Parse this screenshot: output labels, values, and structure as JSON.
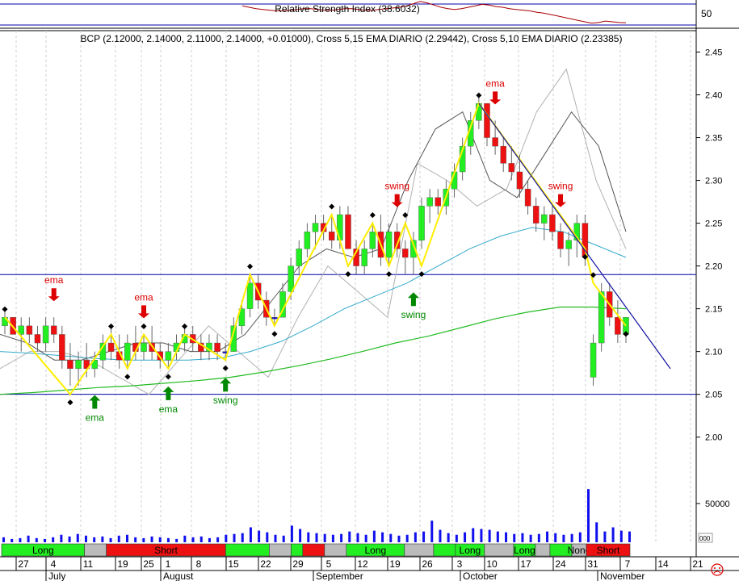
{
  "rsi": {
    "title": "Relative Strength Index (38.6032)",
    "level_label": "50",
    "values": [
      62,
      60,
      58,
      57,
      56,
      55,
      55,
      56,
      57,
      58,
      58,
      57,
      56,
      56,
      57,
      58,
      58,
      57,
      56,
      56,
      57,
      58,
      59,
      60,
      62,
      65,
      68,
      66,
      63,
      60,
      58,
      57,
      58,
      60,
      62,
      64,
      63,
      61,
      60,
      58,
      57,
      56,
      55,
      53,
      52,
      50,
      48,
      46,
      44,
      42,
      40,
      38,
      39,
      41,
      40,
      39,
      38.6
    ]
  },
  "main_title": "BCP (2.12000, 2.14000, 2.11000, 2.14000, +0.01000), Cross 5,15 EMA DIARIO (2.29442), Cross 5,10 EMA DIARIO (2.23385)",
  "chart_data": {
    "type": "candlestick",
    "y_ticks": [
      "2.45",
      "2.40",
      "2.35",
      "2.30",
      "2.25",
      "2.20",
      "2.15",
      "2.10",
      "2.05",
      "2.00"
    ],
    "ylim": [
      1.945,
      2.475
    ],
    "volume_tick": "50000",
    "volume_cut_label": "000",
    "x_ticks": [
      "27",
      "4",
      "11",
      "19",
      "25",
      "1",
      "8",
      "15",
      "22",
      "29",
      "5",
      "12",
      "19",
      "26",
      "3",
      "10",
      "17",
      "24",
      "31",
      "7",
      "14",
      "21"
    ],
    "months": [
      "July",
      "August",
      "September",
      "October",
      "November"
    ],
    "horizontal_lines": [
      2.19,
      2.05
    ],
    "candles": [
      [
        2.13,
        2.15,
        2.12,
        2.14
      ],
      [
        2.14,
        2.14,
        2.12,
        2.12
      ],
      [
        2.12,
        2.14,
        2.1,
        2.13
      ],
      [
        2.13,
        2.14,
        2.11,
        2.12
      ],
      [
        2.12,
        2.13,
        2.1,
        2.11
      ],
      [
        2.11,
        2.14,
        2.1,
        2.13
      ],
      [
        2.13,
        2.14,
        2.11,
        2.12
      ],
      [
        2.12,
        2.13,
        2.08,
        2.09
      ],
      [
        2.09,
        2.11,
        2.06,
        2.08
      ],
      [
        2.08,
        2.1,
        2.06,
        2.09
      ],
      [
        2.09,
        2.11,
        2.07,
        2.08
      ],
      [
        2.08,
        2.1,
        2.07,
        2.09
      ],
      [
        2.09,
        2.12,
        2.08,
        2.11
      ],
      [
        2.11,
        2.13,
        2.09,
        2.1
      ],
      [
        2.1,
        2.12,
        2.08,
        2.09
      ],
      [
        2.09,
        2.12,
        2.08,
        2.11
      ],
      [
        2.11,
        2.13,
        2.09,
        2.1
      ],
      [
        2.1,
        2.12,
        2.09,
        2.11
      ],
      [
        2.11,
        2.13,
        2.09,
        2.1
      ],
      [
        2.1,
        2.11,
        2.08,
        2.09
      ],
      [
        2.09,
        2.11,
        2.08,
        2.1
      ],
      [
        2.1,
        2.12,
        2.09,
        2.11
      ],
      [
        2.11,
        2.13,
        2.1,
        2.12
      ],
      [
        2.12,
        2.13,
        2.1,
        2.11
      ],
      [
        2.11,
        2.12,
        2.09,
        2.1
      ],
      [
        2.1,
        2.12,
        2.09,
        2.11
      ],
      [
        2.11,
        2.12,
        2.09,
        2.1
      ],
      [
        2.1,
        2.11,
        2.09,
        2.1
      ],
      [
        2.1,
        2.14,
        2.1,
        2.13
      ],
      [
        2.13,
        2.16,
        2.12,
        2.15
      ],
      [
        2.15,
        2.19,
        2.14,
        2.18
      ],
      [
        2.18,
        2.19,
        2.15,
        2.16
      ],
      [
        2.16,
        2.17,
        2.13,
        2.14
      ],
      [
        2.14,
        2.15,
        2.13,
        2.14
      ],
      [
        2.14,
        2.18,
        2.14,
        2.17
      ],
      [
        2.17,
        2.21,
        2.16,
        2.2
      ],
      [
        2.2,
        2.23,
        2.19,
        2.22
      ],
      [
        2.22,
        2.25,
        2.21,
        2.24
      ],
      [
        2.24,
        2.26,
        2.22,
        2.25
      ],
      [
        2.25,
        2.26,
        2.23,
        2.24
      ],
      [
        2.24,
        2.26,
        2.22,
        2.23
      ],
      [
        2.23,
        2.27,
        2.22,
        2.26
      ],
      [
        2.26,
        2.27,
        2.22,
        2.22
      ],
      [
        2.22,
        2.23,
        2.19,
        2.2
      ],
      [
        2.2,
        2.23,
        2.19,
        2.22
      ],
      [
        2.22,
        2.25,
        2.21,
        2.24
      ],
      [
        2.24,
        2.26,
        2.2,
        2.21
      ],
      [
        2.21,
        2.25,
        2.2,
        2.24
      ],
      [
        2.24,
        2.25,
        2.21,
        2.22
      ],
      [
        2.22,
        2.23,
        2.19,
        2.21
      ],
      [
        2.21,
        2.24,
        2.19,
        2.23
      ],
      [
        2.23,
        2.28,
        2.22,
        2.27
      ],
      [
        2.27,
        2.29,
        2.25,
        2.28
      ],
      [
        2.28,
        2.29,
        2.26,
        2.27
      ],
      [
        2.27,
        2.3,
        2.26,
        2.29
      ],
      [
        2.29,
        2.32,
        2.28,
        2.31
      ],
      [
        2.31,
        2.35,
        2.3,
        2.34
      ],
      [
        2.34,
        2.38,
        2.33,
        2.37
      ],
      [
        2.37,
        2.4,
        2.36,
        2.39
      ],
      [
        2.39,
        2.39,
        2.34,
        2.35
      ],
      [
        2.35,
        2.37,
        2.33,
        2.34
      ],
      [
        2.34,
        2.35,
        2.31,
        2.32
      ],
      [
        2.32,
        2.34,
        2.3,
        2.31
      ],
      [
        2.31,
        2.33,
        2.28,
        2.29
      ],
      [
        2.29,
        2.3,
        2.26,
        2.27
      ],
      [
        2.27,
        2.28,
        2.24,
        2.25
      ],
      [
        2.25,
        2.27,
        2.23,
        2.26
      ],
      [
        2.26,
        2.27,
        2.23,
        2.24
      ],
      [
        2.24,
        2.25,
        2.21,
        2.22
      ],
      [
        2.22,
        2.24,
        2.2,
        2.23
      ],
      [
        2.23,
        2.26,
        2.21,
        2.25
      ],
      [
        2.25,
        2.26,
        2.2,
        2.21
      ],
      [
        2.07,
        2.12,
        2.06,
        2.11
      ],
      [
        2.11,
        2.18,
        2.1,
        2.17
      ],
      [
        2.17,
        2.18,
        2.13,
        2.14
      ],
      [
        2.14,
        2.16,
        2.11,
        2.12
      ],
      [
        2.12,
        2.14,
        2.11,
        2.14
      ]
    ],
    "ema_green": [
      2.05,
      2.052,
      2.055,
      2.058,
      2.06,
      2.063,
      2.066,
      2.07,
      2.076,
      2.083,
      2.091,
      2.1,
      2.11,
      2.118,
      2.128,
      2.138,
      2.146,
      2.152,
      2.152,
      2.15
    ],
    "ema_cyan": [
      2.1,
      2.098,
      2.095,
      2.092,
      2.09,
      2.09,
      2.09,
      2.092,
      2.1,
      2.112,
      2.13,
      2.15,
      2.165,
      2.18,
      2.2,
      2.22,
      2.235,
      2.245,
      2.24,
      2.225,
      2.21
    ],
    "ema_grey": [
      2.12,
      2.11,
      2.09,
      2.09,
      2.1,
      2.11,
      2.11,
      2.1,
      2.1,
      2.12,
      2.16,
      2.2,
      2.22,
      2.21,
      2.22,
      2.3,
      2.36,
      2.38,
      2.3,
      2.28,
      2.33,
      2.38,
      2.34,
      2.24
    ],
    "ema_lightgrey": [
      2.08,
      2.1,
      2.1,
      2.09,
      2.07,
      2.05,
      2.09,
      2.13,
      2.1,
      2.07,
      2.14,
      2.2,
      2.17,
      2.14,
      2.32,
      2.3,
      2.27,
      2.29,
      2.38,
      2.43,
      2.3,
      2.22
    ],
    "zigzag": [
      [
        2.14,
        0
      ],
      [
        2.05,
        8
      ],
      [
        2.12,
        13
      ],
      [
        2.08,
        15
      ],
      [
        2.12,
        17
      ],
      [
        2.08,
        20
      ],
      [
        2.12,
        22
      ],
      [
        2.09,
        27
      ],
      [
        2.19,
        30
      ],
      [
        2.13,
        33
      ],
      [
        2.26,
        40
      ],
      [
        2.2,
        42
      ],
      [
        2.25,
        45
      ],
      [
        2.2,
        47
      ],
      [
        2.25,
        49
      ],
      [
        2.2,
        51
      ],
      [
        2.39,
        58
      ],
      [
        2.22,
        71
      ],
      [
        2.18,
        72
      ],
      [
        2.13,
        76
      ]
    ],
    "trend_line": [
      [
        2.39,
        58
      ],
      [
        2.08,
        79
      ]
    ],
    "volume": [
      6,
      4,
      5,
      8,
      5,
      4,
      6,
      9,
      7,
      10,
      8,
      6,
      7,
      5,
      8,
      9,
      6,
      5,
      7,
      6,
      5,
      4,
      8,
      6,
      7,
      5,
      6,
      9,
      10,
      11,
      18,
      14,
      12,
      9,
      8,
      20,
      16,
      12,
      11,
      10,
      9,
      10,
      13,
      11,
      9,
      14,
      12,
      10,
      8,
      9,
      12,
      13,
      26,
      15,
      11,
      9,
      12,
      17,
      16,
      15,
      13,
      12,
      10,
      11,
      9,
      10,
      13,
      11,
      9,
      10,
      12,
      64,
      24,
      13,
      18,
      14,
      13
    ],
    "signals": [
      {
        "label": "ema",
        "color": "#dd0000",
        "dir": "down",
        "i": 6
      },
      {
        "label": "ema",
        "color": "#008800",
        "dir": "up",
        "i": 11
      },
      {
        "label": "ema",
        "color": "#dd0000",
        "dir": "down",
        "i": 17
      },
      {
        "label": "ema",
        "color": "#008800",
        "dir": "up",
        "i": 20
      },
      {
        "label": "swing",
        "color": "#008800",
        "dir": "up",
        "i": 27
      },
      {
        "label": "swing",
        "color": "#dd0000",
        "dir": "down",
        "i": 48
      },
      {
        "label": "swing",
        "color": "#008800",
        "dir": "up",
        "i": 50
      },
      {
        "label": "ema",
        "color": "#dd0000",
        "dir": "down",
        "i": 60
      },
      {
        "label": "swing",
        "color": "#dd0000",
        "dir": "down",
        "i": 68
      }
    ],
    "states": [
      {
        "label": "Long",
        "color": "#22ee22"
      },
      {
        "label": "",
        "color": "#bbbbbb"
      },
      {
        "label": "Short",
        "color": "#ee1111"
      },
      {
        "label": "",
        "color": "#22ee22"
      },
      {
        "label": "",
        "color": "#bbbbbb"
      },
      {
        "label": "",
        "color": "#22ee22"
      },
      {
        "label": "",
        "color": "#ee1111"
      },
      {
        "label": "",
        "color": "#bbbbbb"
      },
      {
        "label": "Long",
        "color": "#22ee22"
      },
      {
        "label": "",
        "color": "#bbbbbb"
      },
      {
        "label": "",
        "color": "#22ee22"
      },
      {
        "label": "Long",
        "color": "#22ee22"
      },
      {
        "label": "",
        "color": "#bbbbbb"
      },
      {
        "label": "Long",
        "color": "#22ee22"
      },
      {
        "label": "",
        "color": "#bbbbbb"
      },
      {
        "label": "",
        "color": "#22ee22"
      },
      {
        "label": "None",
        "color": "#bbbbbb"
      },
      {
        "label": "Short",
        "color": "#ee1111"
      }
    ],
    "colors": {
      "axis": "#000000",
      "hline": "#0000aa",
      "trend": "#1010a0",
      "zigzag": "#ffee00",
      "volume": "#1010ee",
      "up": "#22ee22",
      "down": "#ee1111",
      "neutral": "#1010cc",
      "rsi": "#aa0000"
    }
  }
}
